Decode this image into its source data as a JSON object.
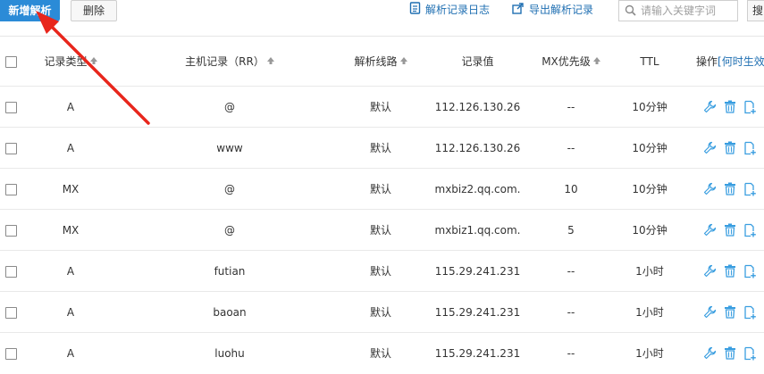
{
  "toolbar": {
    "add_label": "新增解析",
    "delete_label": "删除",
    "log_label": "解析记录日志",
    "export_label": "导出解析记录",
    "search_placeholder": "请输入关键字词",
    "cut_label": "搜"
  },
  "table": {
    "headers": {
      "type": "记录类型",
      "host": "主机记录（RR）",
      "line": "解析线路",
      "value": "记录值",
      "mx": "MX优先级",
      "ttl": "TTL",
      "ops": "操作",
      "ops_link": "[何时生效"
    },
    "rows": [
      {
        "type": "A",
        "host": "@",
        "line": "默认",
        "value": "112.126.130.26",
        "mx": "--",
        "ttl": "10分钟"
      },
      {
        "type": "A",
        "host": "www",
        "line": "默认",
        "value": "112.126.130.26",
        "mx": "--",
        "ttl": "10分钟"
      },
      {
        "type": "MX",
        "host": "@",
        "line": "默认",
        "value": "mxbiz2.qq.com.",
        "mx": "10",
        "ttl": "10分钟"
      },
      {
        "type": "MX",
        "host": "@",
        "line": "默认",
        "value": "mxbiz1.qq.com.",
        "mx": "5",
        "ttl": "10分钟"
      },
      {
        "type": "A",
        "host": "futian",
        "line": "默认",
        "value": "115.29.241.231",
        "mx": "--",
        "ttl": "1小时"
      },
      {
        "type": "A",
        "host": "baoan",
        "line": "默认",
        "value": "115.29.241.231",
        "mx": "--",
        "ttl": "1小时"
      },
      {
        "type": "A",
        "host": "luohu",
        "line": "默认",
        "value": "115.29.241.231",
        "mx": "--",
        "ttl": "1小时"
      }
    ]
  },
  "icons": {
    "edit": "wrench-icon",
    "delete": "trash-icon",
    "pause": "doc-add-icon",
    "sort": "sort-up-icon"
  },
  "colors": {
    "primary": "#2b8bd7",
    "link": "#1f6fb2",
    "icon": "#3a9ee0",
    "arrow": "#e8261c"
  }
}
